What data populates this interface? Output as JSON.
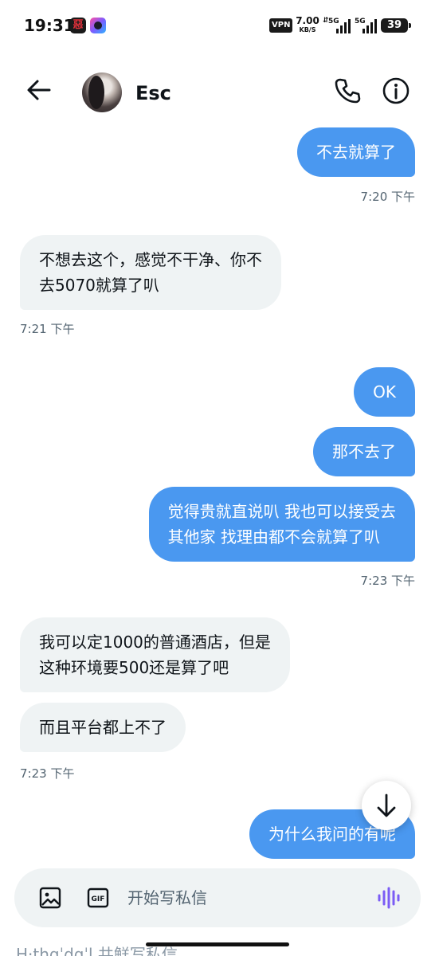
{
  "status_bar": {
    "time": "19:31",
    "vpn": "VPN",
    "speed_value": "7.00",
    "speed_unit": "KB/S",
    "signal1": "5G",
    "signal2": "5G",
    "battery": "39"
  },
  "header": {
    "contact_name": "Esc"
  },
  "messages": [
    {
      "dir": "out",
      "text": "不去就算了"
    },
    {
      "dir": "stamp",
      "text": "7:20 下午"
    },
    {
      "dir": "in",
      "text": "不想去这个，感觉不干净、你不\n去5070就算了叭"
    },
    {
      "dir": "stamp",
      "text": "7:21 下午"
    },
    {
      "dir": "out",
      "text": "OK"
    },
    {
      "dir": "out",
      "text": "那不去了"
    },
    {
      "dir": "out",
      "text": "觉得贵就直说叭 我也可以接受去\n其他家 找理由都不会就算了叭"
    },
    {
      "dir": "stamp",
      "text": "7:23 下午"
    },
    {
      "dir": "in",
      "text": "我可以定1000的普通酒店，但是\n这种环境要500还是算了吧"
    },
    {
      "dir": "in",
      "text": "而且平台都上不了"
    },
    {
      "dir": "stamp",
      "text": "7:23 下午"
    },
    {
      "dir": "out",
      "text": "为什么我问的有呢"
    }
  ],
  "composer": {
    "placeholder": "开始写私信",
    "value": ""
  },
  "below_peek_text": "H·thɑˈdɑˈl  共鲜写私信",
  "colors": {
    "accent_bubble": "#4a98f0",
    "incoming_bubble": "#eff3f4",
    "voice_icon": "#7b5cf5",
    "timestamp": "#536471"
  },
  "icons": {
    "back": "arrow-left-icon",
    "call": "phone-icon",
    "info": "info-icon",
    "scroll": "arrow-down-icon",
    "image": "image-icon",
    "gif": "gif-icon",
    "voice": "voice-wave-icon"
  }
}
